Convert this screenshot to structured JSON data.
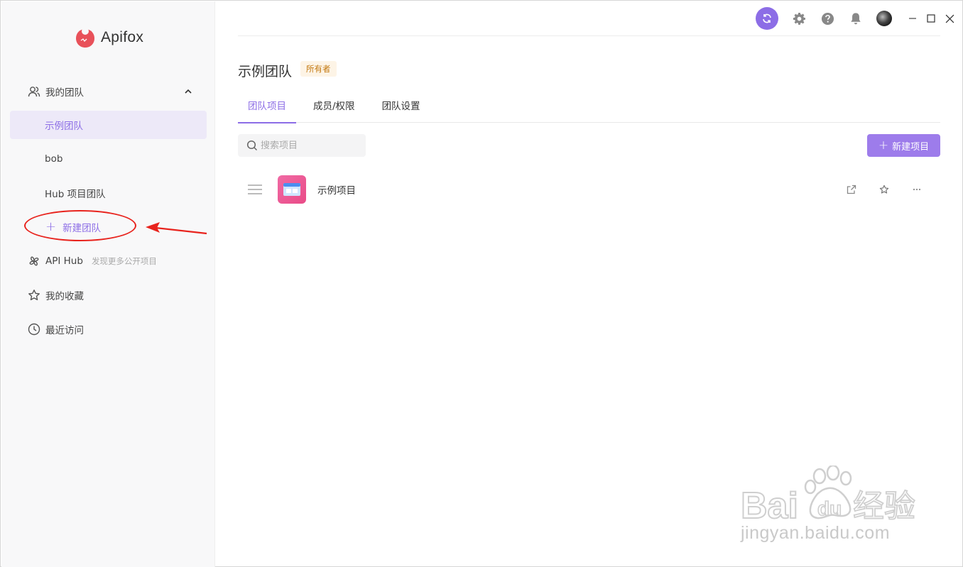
{
  "app": {
    "name": "Apifox"
  },
  "sidebar": {
    "my_teams_label": "我的团队",
    "teams": [
      {
        "label": "示例团队",
        "active": true
      },
      {
        "label": "bob",
        "active": false
      },
      {
        "label": "Hub 项目团队",
        "active": false
      }
    ],
    "new_team_label": "新建团队",
    "api_hub_label": "API Hub",
    "api_hub_sub": "发现更多公开项目",
    "favorites_label": "我的收藏",
    "recent_label": "最近访问"
  },
  "main": {
    "team_title": "示例团队",
    "owner_badge": "所有者",
    "tabs": [
      {
        "label": "团队项目",
        "active": true
      },
      {
        "label": "成员/权限",
        "active": false
      },
      {
        "label": "团队设置",
        "active": false
      }
    ],
    "search_placeholder": "搜索项目",
    "new_project_label": "新建项目",
    "projects": [
      {
        "name": "示例项目"
      }
    ]
  },
  "watermark": {
    "text": "jingyan.baidu.com"
  },
  "colors": {
    "accent": "#8c6de6",
    "annotation": "#e8231d"
  }
}
